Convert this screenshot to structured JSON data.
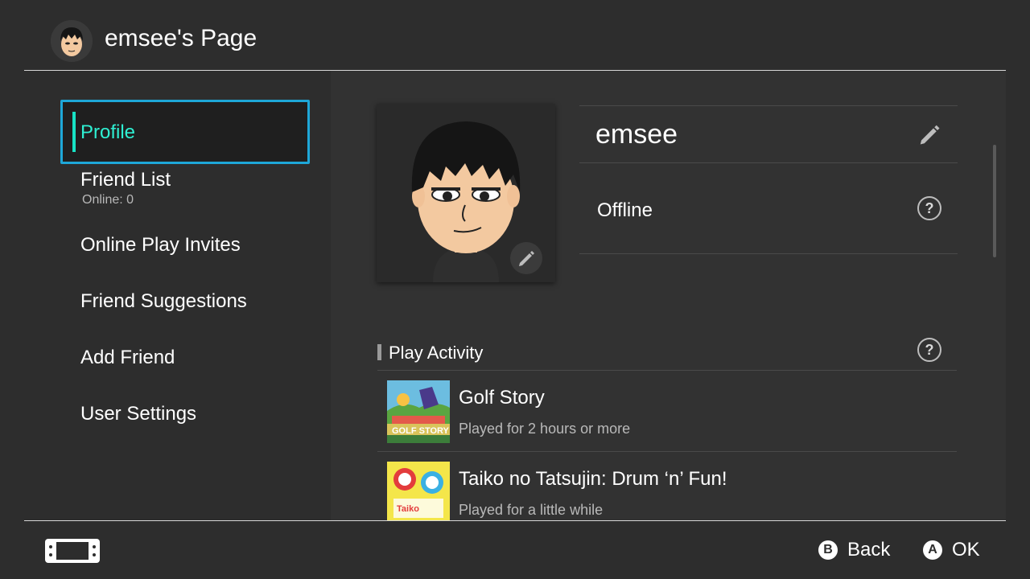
{
  "header": {
    "title": "emsee's Page"
  },
  "sidebar": {
    "items": [
      {
        "label": "Profile"
      },
      {
        "label": "Friend List",
        "sub": "Online: 0"
      },
      {
        "label": "Online Play Invites"
      },
      {
        "label": "Friend Suggestions"
      },
      {
        "label": "Add Friend"
      },
      {
        "label": "User Settings"
      }
    ]
  },
  "profile": {
    "name": "emsee",
    "status": "Offline"
  },
  "activity": {
    "title": "Play Activity",
    "games": [
      {
        "title": "Golf Story",
        "played": "Played for 2 hours or more"
      },
      {
        "title": "Taiko no Tatsujin: Drum ‘n’ Fun!",
        "played": "Played for a little while"
      }
    ]
  },
  "footer": {
    "back_key": "B",
    "back_label": "Back",
    "ok_key": "A",
    "ok_label": "OK"
  },
  "icons": {
    "edit": "pencil-icon",
    "help": "question-icon",
    "console": "console-icon"
  },
  "colors": {
    "selected_text": "#2ff0d3",
    "selected_border": "#1ea7d8",
    "background": "#2d2d2d"
  }
}
